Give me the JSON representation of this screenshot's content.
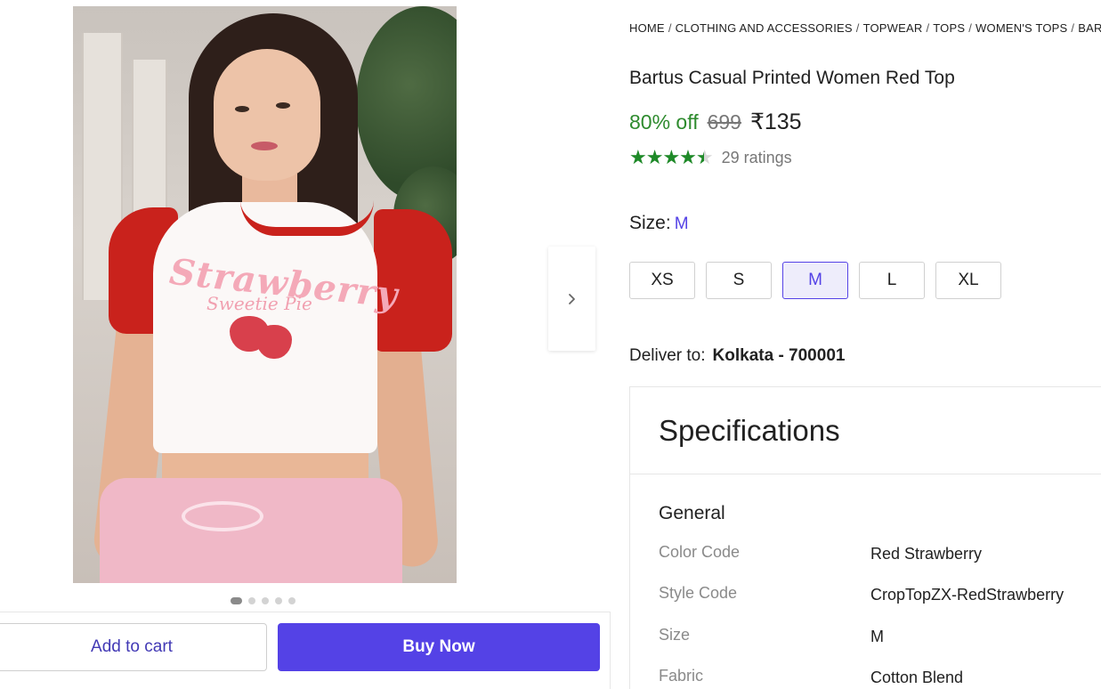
{
  "breadcrumb": [
    "HOME",
    "CLOTHING AND ACCESSORIES",
    "TOPWEAR",
    "TOPS",
    "WOMEN'S TOPS",
    "BARTUS"
  ],
  "product": {
    "title": "Bartus Casual Printed Women Red Top",
    "discount": "80% off",
    "mrp": "699",
    "price": "₹135",
    "rating_value": 4.5,
    "rating_count": "29 ratings",
    "image_print_line1": "Strawberry",
    "image_print_line2": "Sweetie Pie"
  },
  "carousel": {
    "total": 5,
    "active_index": 0
  },
  "size": {
    "label": "Size:",
    "selected": "M",
    "options": [
      "XS",
      "S",
      "M",
      "L",
      "XL"
    ]
  },
  "delivery": {
    "label": "Deliver to:",
    "location": "Kolkata - 700001"
  },
  "specifications": {
    "heading": "Specifications",
    "group": "General",
    "rows": [
      {
        "key": "Color Code",
        "value": "Red Strawberry"
      },
      {
        "key": "Style Code",
        "value": "CropTopZX-RedStrawberry"
      },
      {
        "key": "Size",
        "value": "M"
      },
      {
        "key": "Fabric",
        "value": "Cotton Blend"
      }
    ]
  },
  "actions": {
    "add_to_cart": "Add to cart",
    "buy_now": "Buy Now"
  },
  "colors": {
    "accent": "#5442e6",
    "discount": "#2e8b2e",
    "star": "#1e8a28"
  }
}
